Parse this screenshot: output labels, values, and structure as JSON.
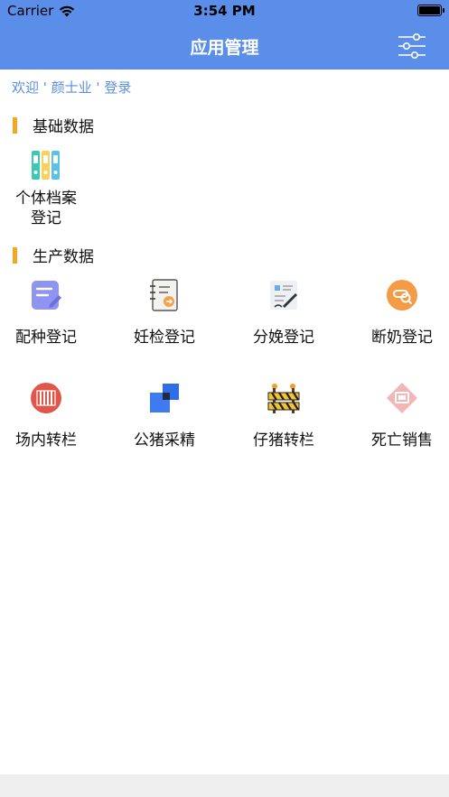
{
  "status": {
    "carrier": "Carrier",
    "time": "3:54 PM"
  },
  "nav": {
    "title": "应用管理",
    "filter_icon": "filter-sliders-icon"
  },
  "welcome": {
    "text": "欢迎 ' 颜士业 ' 登录"
  },
  "sections": {
    "basic": {
      "title": "基础数据"
    },
    "production": {
      "title": "生产数据"
    }
  },
  "basic_items": [
    {
      "line1": "个体档案",
      "line2": "登记",
      "icon": "binders-icon"
    }
  ],
  "production_items": [
    {
      "label": "配种登记",
      "icon": "edit-note-icon"
    },
    {
      "label": "妊检登记",
      "icon": "notebook-arrow-icon"
    },
    {
      "label": "分娩登记",
      "icon": "document-sign-icon"
    },
    {
      "label": "断奶登记",
      "icon": "bottle-badge-icon"
    },
    {
      "label": "场内转栏",
      "icon": "pen-fence-icon"
    },
    {
      "label": "公猪采精",
      "icon": "overlap-squares-icon"
    },
    {
      "label": "仔猪转栏",
      "icon": "barrier-icon"
    },
    {
      "label": "死亡销售",
      "icon": "diamond-sign-icon"
    }
  ],
  "colors": {
    "primary": "#5a8ee8",
    "section_accent": "#f5a623",
    "footer": "#efefef"
  }
}
